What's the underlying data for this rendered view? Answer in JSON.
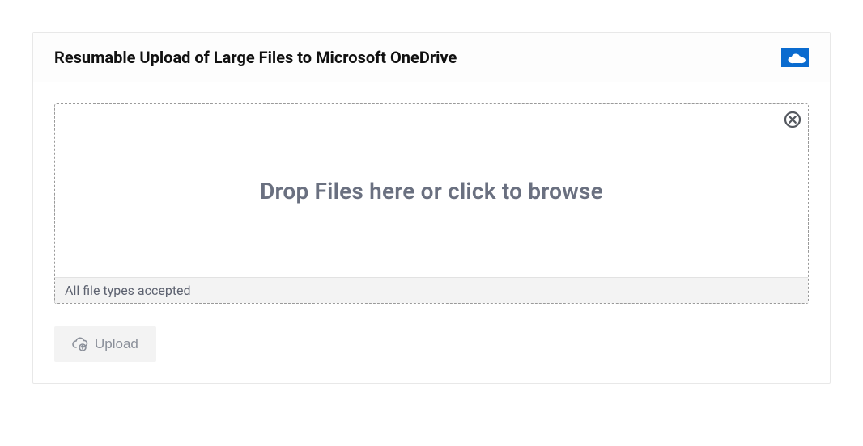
{
  "header": {
    "title": "Resumable Upload of Large Files to Microsoft OneDrive",
    "icon": "onedrive-icon"
  },
  "dropzone": {
    "prompt": "Drop Files here or click to browse",
    "footer": "All file types accepted",
    "close_icon": "close-circle-icon"
  },
  "actions": {
    "upload_label": "Upload",
    "upload_icon": "cloud-upload-icon"
  },
  "colors": {
    "accent": "#0a6bcf",
    "text_muted": "#6a7080",
    "border_dash": "#9a9a9a",
    "footer_bg": "#f3f3f3"
  }
}
